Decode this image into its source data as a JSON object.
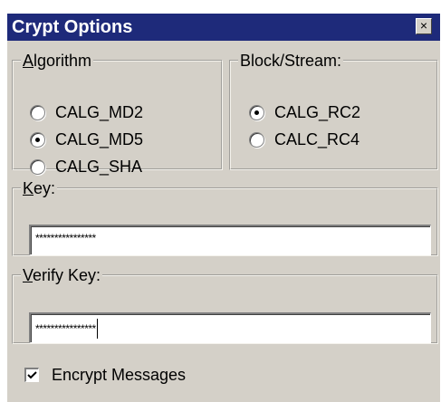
{
  "window": {
    "title": "Crypt Options",
    "close_glyph": "×",
    "close_icon": "close-icon"
  },
  "algorithm": {
    "legend_accel": "A",
    "legend_rest": "lgorithm",
    "options": [
      {
        "label": "CALG_MD2",
        "checked": false
      },
      {
        "label": "CALG_MD5",
        "checked": true
      },
      {
        "label": "CALG_SHA",
        "checked": false
      }
    ]
  },
  "block_stream": {
    "legend": "Block/Stream:",
    "options": [
      {
        "label": "CALG_RC2",
        "checked": true
      },
      {
        "label": "CALC_RC4",
        "checked": false
      }
    ]
  },
  "key": {
    "legend_accel": "K",
    "legend_rest": "ey:",
    "value": "****************"
  },
  "verify_key": {
    "legend_accel": "V",
    "legend_rest": "erify Key:",
    "value": "****************"
  },
  "encrypt": {
    "label": "Encrypt Messages",
    "checked": true,
    "check_icon": "checkmark-icon"
  }
}
